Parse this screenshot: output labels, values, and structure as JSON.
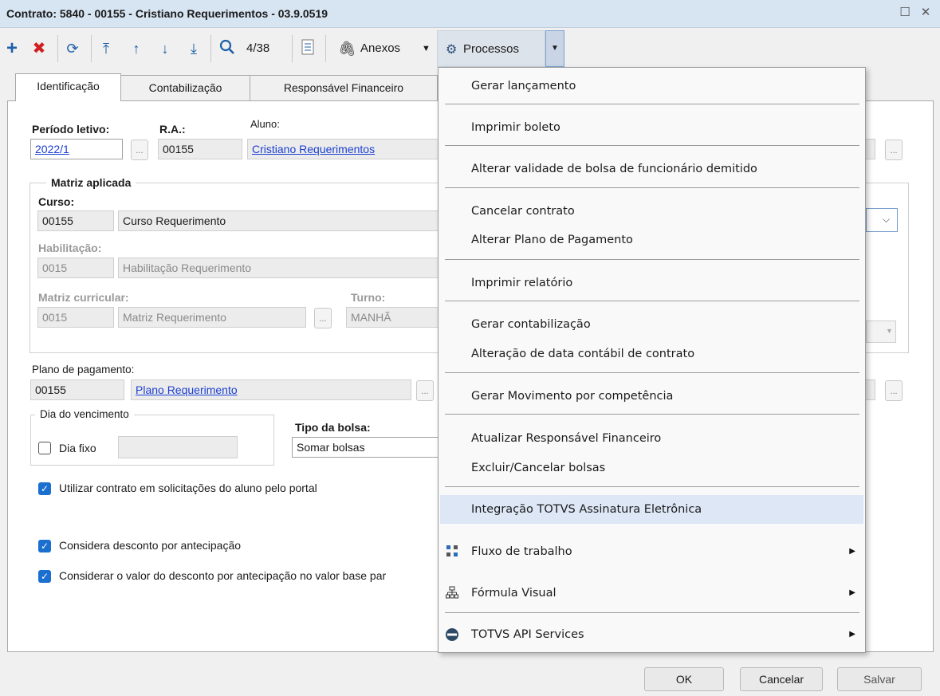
{
  "window": {
    "title": "Contrato: 5840 - 00155 - Cristiano Requerimentos - 03.9.0519",
    "maximize": "☐",
    "close": "✕"
  },
  "toolbar": {
    "record_position": "4/38",
    "attachments": "Anexos",
    "processes": "Processos"
  },
  "tabs": [
    "Identificação",
    "Contabilização",
    "Responsável Financeiro"
  ],
  "form": {
    "periodo_label": "Período letivo:",
    "periodo_value": "2022/1",
    "ra_label": "R.A.:",
    "ra_value": "00155",
    "aluno_label": "Aluno:",
    "aluno_value": "Cristiano Requerimentos",
    "matriz_group": "Matriz aplicada",
    "curso_label": "Curso:",
    "curso_code": "00155",
    "curso_name": "Curso Requerimento",
    "habilitacao_label": "Habilitação:",
    "habilitacao_code": "0015",
    "habilitacao_name": "Habilitação Requerimento",
    "matriz_label": "Matriz curricular:",
    "matriz_code": "0015",
    "matriz_name": "Matriz Requerimento",
    "turno_label": "Turno:",
    "turno_value": "MANHÃ",
    "plano_label": "Plano de pagamento:",
    "plano_code": "00155",
    "plano_name": "Plano Requerimento",
    "vencimento_group": "Dia do vencimento",
    "dia_fixo_label": "Dia fixo",
    "dia_fixo_checked": false,
    "tipo_bolsa_label": "Tipo da bolsa:",
    "tipo_bolsa_value": "Somar bolsas",
    "chk_portal": "Utilizar contrato em solicitações do aluno pelo portal",
    "chk_antecipacao": "Considera desconto por antecipação",
    "chk_valor_base": "Considerar o valor do desconto por antecipação no valor base par"
  },
  "menu": {
    "items": [
      "Gerar lançamento",
      "Imprimir boleto",
      "Alterar validade de bolsa de funcionário demitido",
      "Cancelar contrato",
      "Alterar Plano de Pagamento",
      "Imprimir relatório",
      "Gerar contabilização",
      "Alteração de data contábil de contrato",
      "Gerar Movimento por competência",
      "Atualizar Responsável Financeiro",
      "Excluir/Cancelar bolsas",
      "Integração TOTVS Assinatura Eletrônica",
      "Fluxo de trabalho",
      "Fórmula Visual",
      "TOTVS API Services"
    ],
    "highlighted": "Integração TOTVS Assinatura Eletrônica"
  },
  "buttons": {
    "ok": "OK",
    "cancel": "Cancelar",
    "save": "Salvar"
  },
  "colors": {
    "title_bar": "#d7e4f2",
    "link": "#1b3fd1",
    "checkbox": "#1a6fcf",
    "menu_highlight": "#dde7f6",
    "delete_icon": "#d11f1f"
  }
}
